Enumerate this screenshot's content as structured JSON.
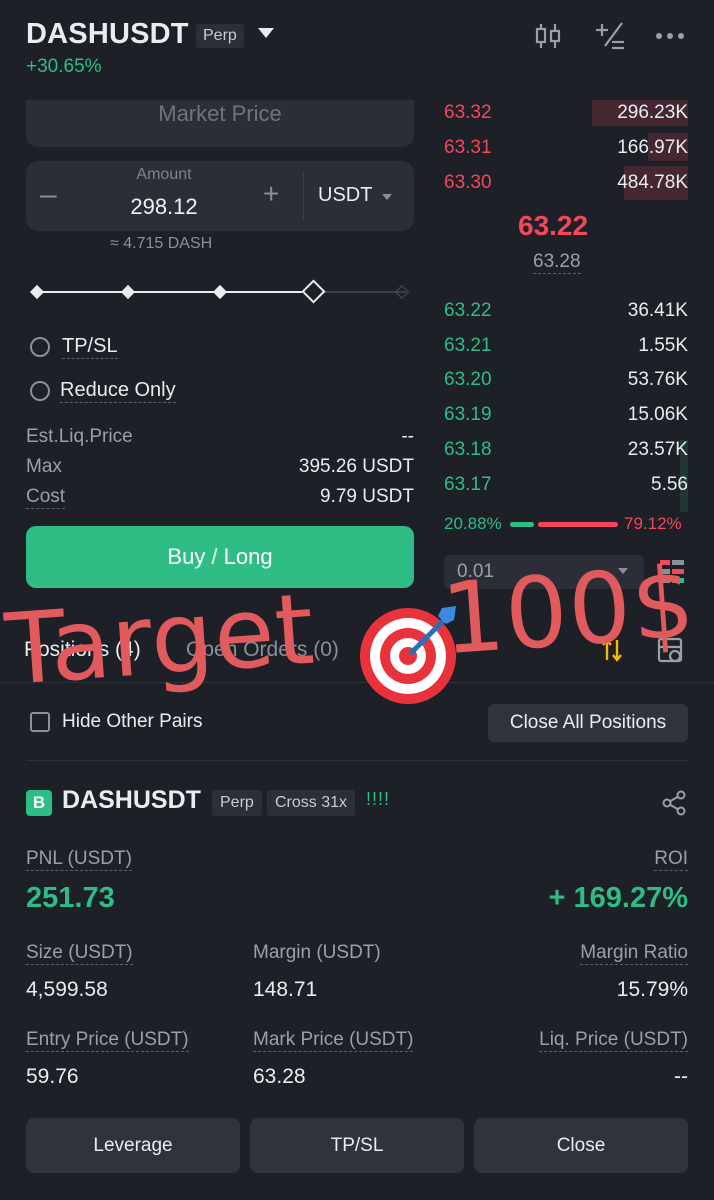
{
  "header": {
    "pair": "DASHUSDT",
    "contract_tag": "Perp",
    "change_24h": "+30.65%",
    "icons": [
      "candlestick-chart-icon",
      "calculator-icon",
      "more-icon"
    ]
  },
  "order_form": {
    "market_price_label": "Market Price",
    "amount_label": "Amount",
    "amount_value": "298.12",
    "currency": "USDT",
    "approx_quantity": "≈ 4.715 DASH",
    "slider_percent": 75,
    "tpsl_label": "TP/SL",
    "reduce_only_label": "Reduce Only",
    "est_liq_label": "Est.Liq.Price",
    "est_liq_value": "--",
    "max_label": "Max",
    "max_value": "395.26 USDT",
    "cost_label": "Cost",
    "cost_value": "9.79 USDT",
    "buy_label": "Buy / Long"
  },
  "order_book": {
    "asks": [
      {
        "price": "63.32",
        "qty": "296.23K"
      },
      {
        "price": "63.31",
        "qty": "166.97K"
      },
      {
        "price": "63.30",
        "qty": "484.78K"
      }
    ],
    "last_price": "63.22",
    "mark_price": "63.28",
    "bids": [
      {
        "price": "63.22",
        "qty": "36.41K"
      },
      {
        "price": "63.21",
        "qty": "1.55K"
      },
      {
        "price": "63.20",
        "qty": "53.76K"
      },
      {
        "price": "63.19",
        "qty": "15.06K"
      },
      {
        "price": "63.18",
        "qty": "23.57K"
      },
      {
        "price": "63.17",
        "qty": "5.56"
      }
    ],
    "bid_ratio": "20.88%",
    "ask_ratio": "79.12%",
    "precision": "0.01",
    "colors": {
      "bid": "#2ebd85",
      "ask": "#f6465d"
    }
  },
  "tabs": {
    "positions": "Positions (4)",
    "open_orders": "Open Orders (0)"
  },
  "positions_toolbar": {
    "hide_other_pairs": "Hide Other Pairs",
    "close_all": "Close All Positions"
  },
  "position": {
    "side_badge": "B",
    "pair": "DASHUSDT",
    "contract_tag": "Perp",
    "margin_mode": "Cross 31x",
    "alert_marks": "!!!!",
    "pnl_label": "PNL (USDT)",
    "pnl_value": "251.73",
    "roi_label": "ROI",
    "roi_value": "+ 169.27%",
    "size_label": "Size (USDT)",
    "size_value": "4,599.58",
    "margin_label": "Margin (USDT)",
    "margin_value": "148.71",
    "margin_ratio_label": "Margin Ratio",
    "margin_ratio_value": "15.79%",
    "entry_label": "Entry Price (USDT)",
    "entry_value": "59.76",
    "mark_label": "Mark Price (USDT)",
    "mark_value": "63.28",
    "liq_label": "Liq. Price (USDT)",
    "liq_value": "--",
    "buttons": {
      "leverage": "Leverage",
      "tpsl": "TP/SL",
      "close": "Close"
    }
  },
  "overlay": {
    "text": "Target",
    "amount": "100$"
  }
}
